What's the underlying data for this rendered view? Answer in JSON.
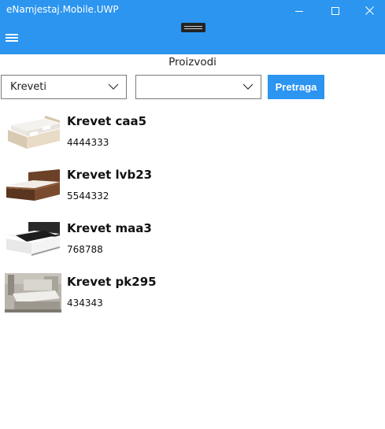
{
  "window": {
    "title": "eNamjestaj.Mobile.UWP"
  },
  "page": {
    "title": "Proizvodi"
  },
  "filters": {
    "category_selected": "Kreveti",
    "second_selected": "",
    "search_label": "Pretraga"
  },
  "products": [
    {
      "name": "Krevet caa5",
      "code": "4444333",
      "image_icon": "bed-white-icon"
    },
    {
      "name": "Krevet lvb23",
      "code": "5544332",
      "image_icon": "bed-walnut-icon"
    },
    {
      "name": "Krevet maa3",
      "code": "768788",
      "image_icon": "bed-black-icon"
    },
    {
      "name": "Krevet pk295",
      "code": "434343",
      "image_icon": "bed-grey-icon"
    }
  ],
  "colors": {
    "accent": "#2b95f0",
    "text": "#111111",
    "border": "#7a7a7a"
  }
}
